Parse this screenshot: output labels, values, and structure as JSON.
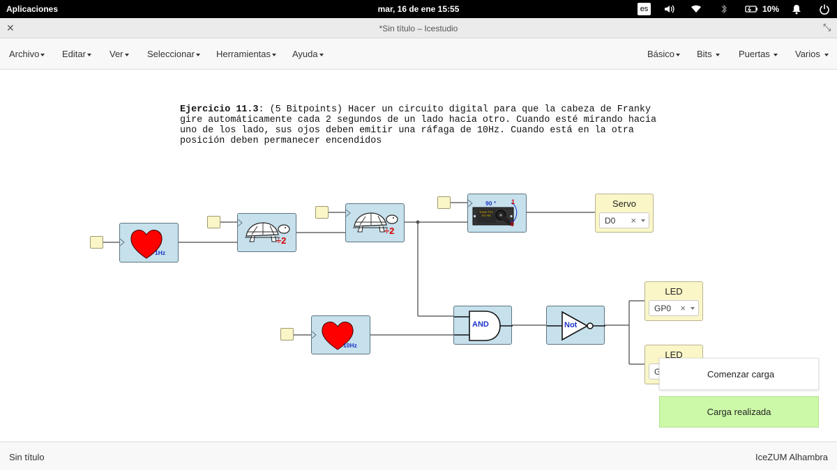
{
  "topbar": {
    "apps": "Aplicaciones",
    "clock": "mar, 16 de ene    15:55",
    "lang": "es",
    "battery": "10%"
  },
  "window": {
    "title": "*Sin título – Icestudio"
  },
  "menu": {
    "left": [
      "Archivo",
      "Editar",
      "Ver",
      "Seleccionar",
      "Herramientas",
      "Ayuda"
    ],
    "right": [
      "Básico",
      "Bits",
      "Puertas",
      "Varios"
    ]
  },
  "exercise": {
    "heading": "Ejercicio 11.3",
    "lines": [
      ": (5 Bitpoints) Hacer un circuito digital para que la cabeza de Franky",
      "gire automáticamente cada 2 segundos de un lado hacia otro. Cuando esté mirando hacia",
      "uno de los lado, sus ojos deben emitir una ráfaga de 10Hz. Cuando está en la otra",
      "posición deben permanecer encendidos"
    ]
  },
  "blocks": {
    "heart1": "1Hz",
    "turtle1": "÷2",
    "turtle2": "÷2",
    "servo_angle": "90 °",
    "servo_one": "1",
    "servo_zero": "0",
    "servo_board": "Tower Pro SG-90",
    "heart2": "10Hz",
    "and_gate": "AND",
    "not_gate": "Not"
  },
  "outputs": {
    "servo": {
      "title": "Servo",
      "value": "D0"
    },
    "led1": {
      "title": "LED",
      "value": "GP0"
    },
    "led2": {
      "title": "LED",
      "value": "G"
    }
  },
  "toasts": {
    "start": "Comenzar carga",
    "done": "Carga realizada"
  },
  "status": {
    "left": "Sin título",
    "right": "IceZUM Alhambra"
  },
  "colors": {
    "block_fill": "#c6e0ec",
    "io_fill": "#fbf6c7",
    "heart": "#ff0000",
    "toast_success": "#ccf9a8"
  }
}
